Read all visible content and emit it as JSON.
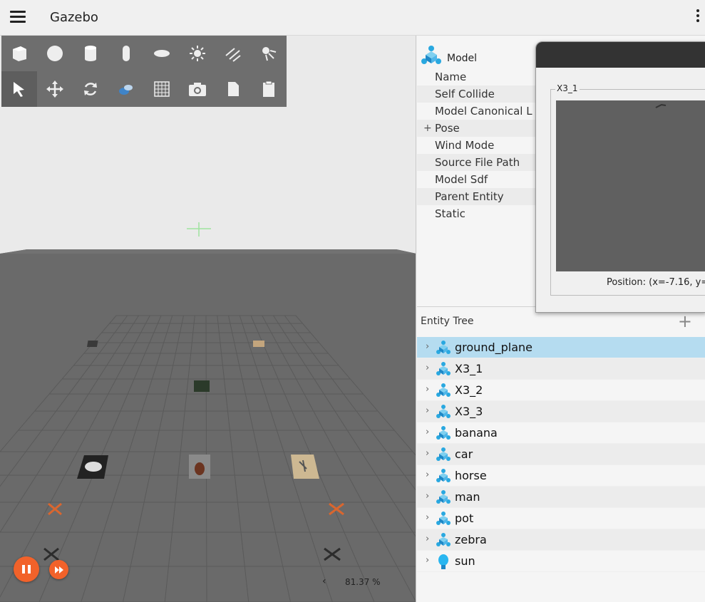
{
  "app": {
    "title": "Gazebo"
  },
  "scene": {
    "rtf": "81.37 %",
    "accent": "#f2622a"
  },
  "toolbar": {
    "row1": [
      "box-icon",
      "sphere-icon",
      "cylinder-icon",
      "capsule-icon",
      "ellipsoid-icon",
      "sun-icon",
      "directional-light-icon",
      "spot-light-icon"
    ],
    "row2": [
      "select-icon",
      "translate-icon",
      "rotate-icon",
      "scale-icon",
      "grid-icon",
      "screenshot-icon",
      "copy-icon",
      "paste-icon"
    ]
  },
  "component": {
    "title": "Model",
    "props": [
      {
        "label": "Name"
      },
      {
        "label": "Self Collide"
      },
      {
        "label": "Model Canonical L"
      },
      {
        "label": "Pose",
        "expandable": true
      },
      {
        "label": "Wind Mode"
      },
      {
        "label": "Source File Path"
      },
      {
        "label": "Model Sdf"
      },
      {
        "label": "Parent Entity"
      },
      {
        "label": "Static"
      }
    ]
  },
  "camera_dialog": {
    "group_label": "X3_1",
    "position": "Position: (x=-7.16, y="
  },
  "entity_tree": {
    "title": "Entity Tree",
    "add_label": "+",
    "items": [
      {
        "label": "ground_plane",
        "icon": "model-icon",
        "selected": true
      },
      {
        "label": "X3_1",
        "icon": "model-icon"
      },
      {
        "label": "X3_2",
        "icon": "model-icon"
      },
      {
        "label": "X3_3",
        "icon": "model-icon"
      },
      {
        "label": "banana",
        "icon": "model-icon"
      },
      {
        "label": "car",
        "icon": "model-icon"
      },
      {
        "label": "horse",
        "icon": "model-icon"
      },
      {
        "label": "man",
        "icon": "model-icon"
      },
      {
        "label": "pot",
        "icon": "model-icon"
      },
      {
        "label": "zebra",
        "icon": "model-icon"
      },
      {
        "label": "sun",
        "icon": "light-bulb-icon"
      }
    ]
  }
}
